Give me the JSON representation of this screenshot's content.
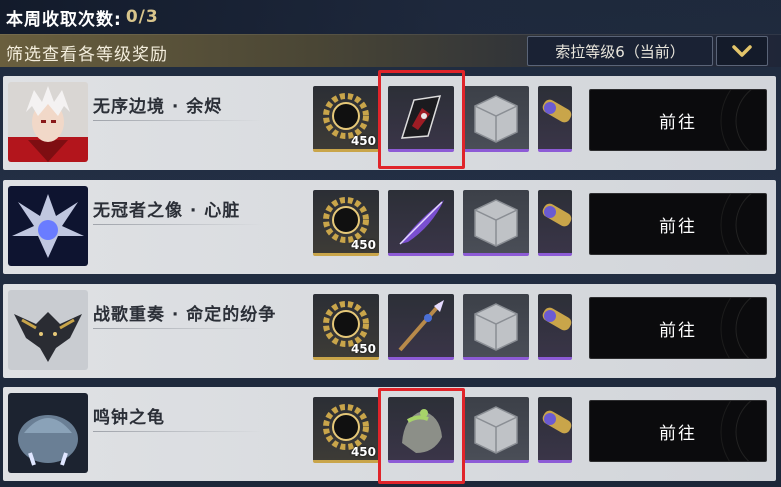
{
  "header": {
    "weekly_label": "本周收取次数:",
    "weekly_count": "0/3"
  },
  "filter": {
    "title": "筛选查看各等级奖励",
    "selected_level": "索拉等级6（当前）"
  },
  "bosses": [
    {
      "name": "无序边境 · 余烬",
      "go_label": "前往",
      "rewards": [
        {
          "icon": "gear-ring-icon",
          "count": "450"
        },
        {
          "icon": "crimson-shard-icon"
        },
        {
          "icon": "stone-cube-icon"
        },
        {
          "icon": "purple-tube-icon"
        }
      ]
    },
    {
      "name": "无冠者之像 · 心脏",
      "go_label": "前往",
      "rewards": [
        {
          "icon": "gear-ring-icon",
          "count": "450"
        },
        {
          "icon": "violet-feather-icon"
        },
        {
          "icon": "stone-cube-icon"
        },
        {
          "icon": "purple-tube-icon"
        }
      ]
    },
    {
      "name": "战歌重奏 · 命定的纷争",
      "go_label": "前往",
      "rewards": [
        {
          "icon": "gear-ring-icon",
          "count": "450"
        },
        {
          "icon": "ornate-spear-icon"
        },
        {
          "icon": "stone-cube-icon"
        },
        {
          "icon": "purple-tube-icon"
        }
      ]
    },
    {
      "name": "鸣钟之龟",
      "go_label": "前往",
      "rewards": [
        {
          "icon": "gear-ring-icon",
          "count": "450"
        },
        {
          "icon": "mossy-stone-icon"
        },
        {
          "icon": "stone-cube-icon"
        },
        {
          "icon": "purple-tube-icon"
        }
      ]
    }
  ],
  "colors": {
    "highlight": "#e0242a",
    "gold_accent": "#c9a54a",
    "purple_accent": "#8d5bd6"
  }
}
